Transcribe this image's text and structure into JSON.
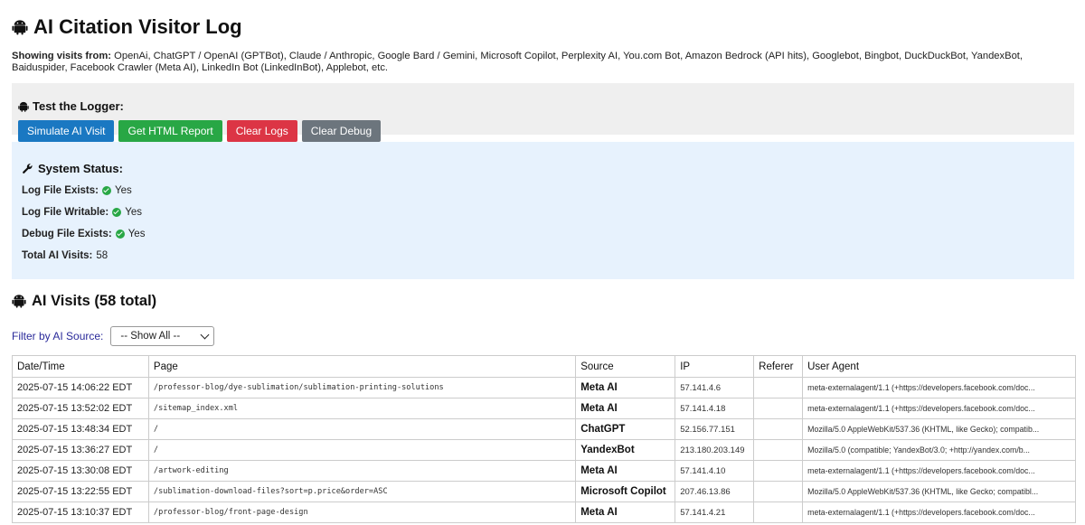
{
  "page": {
    "title": "AI Citation Visitor Log",
    "showing_label": "Showing visits from:",
    "showing_text": "OpenAi, ChatGPT / OpenAI (GPTBot), Claude / Anthropic, Google Bard / Gemini, Microsoft Copilot, Perplexity AI, You.com Bot, Amazon Bedrock (API hits), Googlebot, Bingbot, DuckDuckBot, YandexBot, Baiduspider, Facebook Crawler (Meta AI), LinkedIn Bot (LinkedInBot), Applebot, etc."
  },
  "test": {
    "heading": "Test the Logger:",
    "buttons": {
      "simulate": "Simulate AI Visit",
      "report": "Get HTML Report",
      "clear_logs": "Clear Logs",
      "clear_debug": "Clear Debug"
    }
  },
  "status": {
    "heading": "System Status:",
    "log_exists_label": "Log File Exists:",
    "log_exists_value": "Yes",
    "log_writable_label": "Log File Writable:",
    "log_writable_value": "Yes",
    "debug_exists_label": "Debug File Exists:",
    "debug_exists_value": "Yes",
    "total_label": "Total AI Visits:",
    "total_value": "58"
  },
  "visits": {
    "heading": "AI Visits (58 total)",
    "filter_label": "Filter by AI Source:",
    "filter_value": "-- Show All --",
    "columns": [
      "Date/Time",
      "Page",
      "Source",
      "IP",
      "Referer",
      "User Agent"
    ],
    "rows": [
      {
        "dt": "2025-07-15 14:06:22 EDT",
        "page": "/professor-blog/dye-sublimation/sublimation-printing-solutions",
        "source": "Meta AI",
        "ip": "57.141.4.6",
        "referer": "",
        "ua": "meta-externalagent/1.1 (+https://developers.facebook.com/doc..."
      },
      {
        "dt": "2025-07-15 13:52:02 EDT",
        "page": "/sitemap_index.xml",
        "source": "Meta AI",
        "ip": "57.141.4.18",
        "referer": "",
        "ua": "meta-externalagent/1.1 (+https://developers.facebook.com/doc..."
      },
      {
        "dt": "2025-07-15 13:48:34 EDT",
        "page": "/",
        "source": "ChatGPT",
        "ip": "52.156.77.151",
        "referer": "",
        "ua": "Mozilla/5.0 AppleWebKit/537.36 (KHTML, like Gecko); compatib..."
      },
      {
        "dt": "2025-07-15 13:36:27 EDT",
        "page": "/",
        "source": "YandexBot",
        "ip": "213.180.203.149",
        "referer": "",
        "ua": "Mozilla/5.0 (compatible; YandexBot/3.0; +http://yandex.com/b..."
      },
      {
        "dt": "2025-07-15 13:30:08 EDT",
        "page": "/artwork-editing",
        "source": "Meta AI",
        "ip": "57.141.4.10",
        "referer": "",
        "ua": "meta-externalagent/1.1 (+https://developers.facebook.com/doc..."
      },
      {
        "dt": "2025-07-15 13:22:55 EDT",
        "page": "/sublimation-download-files?sort=p.price&order=ASC",
        "source": "Microsoft Copilot",
        "ip": "207.46.13.86",
        "referer": "",
        "ua": "Mozilla/5.0 AppleWebKit/537.36 (KHTML, like Gecko; compatibl..."
      },
      {
        "dt": "2025-07-15 13:10:37 EDT",
        "page": "/professor-blog/front-page-design",
        "source": "Meta AI",
        "ip": "57.141.4.21",
        "referer": "",
        "ua": "meta-externalagent/1.1 (+https://developers.facebook.com/doc..."
      }
    ]
  }
}
